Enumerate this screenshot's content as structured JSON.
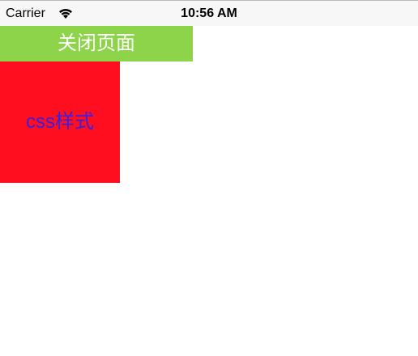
{
  "status_bar": {
    "carrier": "Carrier",
    "time": "10:56 AM",
    "wifi_icon": "wifi-icon"
  },
  "main": {
    "close_button_label": "关闭页面",
    "styled_box_text": "css样式"
  },
  "colors": {
    "close_button_bg": "#8dd44a",
    "close_button_text": "#ffffff",
    "box_bg": "#ff0e20",
    "box_text": "#3a1fe0",
    "status_bar_bg": "#f7f7f7"
  }
}
